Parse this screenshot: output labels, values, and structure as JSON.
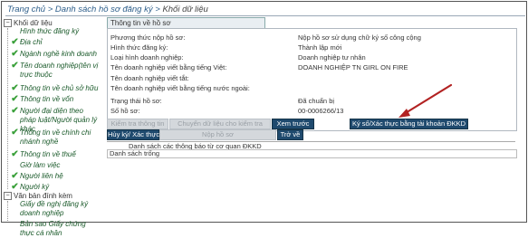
{
  "breadcrumb": {
    "home": "Trang chủ",
    "sep": ">",
    "list": "Danh sách hồ sơ đăng ký",
    "current": "Khối dữ liệu"
  },
  "sidebar": {
    "data_block": "Khối dữ liệu",
    "items": [
      {
        "label": "Hình thức đăng ký",
        "checked": false
      },
      {
        "label": "Địa chỉ",
        "checked": true
      },
      {
        "label": "Ngành nghề kinh doanh",
        "checked": true
      },
      {
        "label": "Tên doanh nghiệp(tên vị trực thuộc",
        "checked": true
      },
      {
        "label": "Thông tin về chủ sở hữu",
        "checked": true
      },
      {
        "label": "Thông tin về vốn",
        "checked": true
      },
      {
        "label": "Người đại diện theo pháp luật/Người quản lý khác",
        "checked": true
      },
      {
        "label": "Thông tin về chính chi nhánh nghề",
        "checked": true
      },
      {
        "label": "Thông tin về thuế",
        "checked": true
      },
      {
        "label": "Giờ làm việc",
        "checked": false
      },
      {
        "label": "Người liên hệ",
        "checked": true
      },
      {
        "label": "Người ký",
        "checked": true
      }
    ],
    "attachments": "Văn bản đính kèm",
    "attach_items": [
      {
        "label": "Giấy đề nghị đăng ký doanh nghiệp"
      },
      {
        "label": "Bản sao Giấy chứng thực cá nhân"
      }
    ]
  },
  "panel": {
    "header": "Thông tin về hồ sơ",
    "rows": [
      {
        "label": "Phương thức nộp hồ sơ:",
        "value": "Nộp hồ sơ sử dụng chữ ký số công cộng"
      },
      {
        "label": "Hình thức đăng ký:",
        "value": "Thành lập mới"
      },
      {
        "label": "Loại hình doanh nghiệp:",
        "value": "Doanh nghiệp tư nhân"
      },
      {
        "label": "Tên doanh nghiệp viết bằng tiếng Việt:",
        "value": "DOANH NGHIỆP TN GIRL ON FIRE"
      },
      {
        "label": "Tên doanh nghiệp viết tắt:",
        "value": ""
      },
      {
        "label": "Tên doanh nghiệp viết bằng tiếng nước ngoài:",
        "value": ""
      },
      {
        "label": "Trạng thái hồ sơ:",
        "value": "Đã chuẩn bị"
      },
      {
        "label": "Số hồ sơ:",
        "value": "00-0006266/13"
      }
    ]
  },
  "buttons": {
    "row1": [
      {
        "label": "Kiểm tra thông tin",
        "enabled": false
      },
      {
        "label": "Chuyển dữ liệu cho kiểm tra",
        "enabled": false
      },
      {
        "label": "Xem trước",
        "enabled": true
      },
      {
        "label": "Ký số/Xác thực bằng tài khoản ĐKKD",
        "enabled": true
      }
    ],
    "row2": [
      {
        "label": "Hủy ký/ Xác thực",
        "enabled": true
      },
      {
        "label": "Nộp hồ sơ",
        "enabled": false
      },
      {
        "label": "Trở về",
        "enabled": true
      }
    ]
  },
  "notices": {
    "header": "Danh sách các thông báo từ cơ quan ĐKKD",
    "empty": "Danh sách trống"
  },
  "colors": {
    "accent": "#1f4a6e",
    "check": "#3aa03a",
    "arrow": "#b22222"
  }
}
